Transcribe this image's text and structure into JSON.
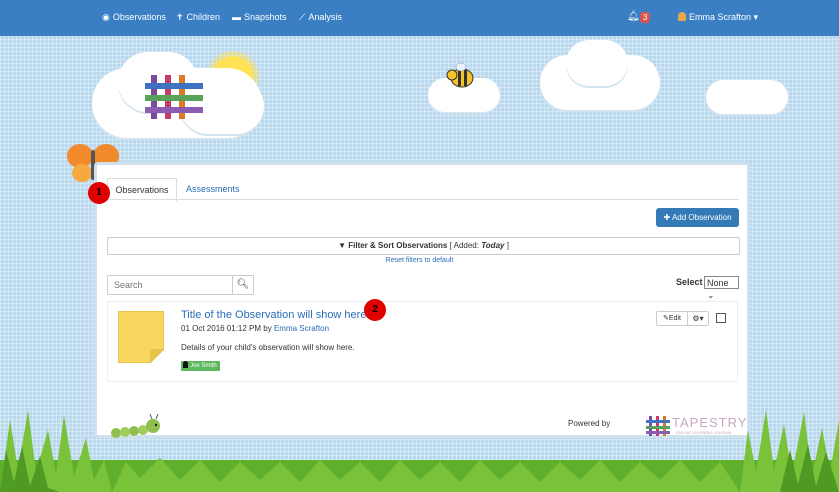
{
  "nav": {
    "items": [
      {
        "label": "Observations",
        "icon": "eye-icon"
      },
      {
        "label": "Children",
        "icon": "child-icon"
      },
      {
        "label": "Snapshots",
        "icon": "snapshot-icon"
      },
      {
        "label": "Analysis",
        "icon": "chart-icon"
      }
    ],
    "notification_count": "3",
    "user_name": "Emma Scrafton"
  },
  "tabs": [
    "Observations",
    "Assessments"
  ],
  "add_button": "Add Observation",
  "filter": {
    "label": "Filter & Sort Observations",
    "added_prefix": "[ Added: ",
    "added_value": "Today",
    "added_suffix": " ]",
    "reset_link": "Reset filters to default"
  },
  "search": {
    "placeholder": "Search"
  },
  "select": {
    "label": "Select",
    "value": "None"
  },
  "observation": {
    "title": "Title of the Observation will show here",
    "date": "01 Oct 2016 01:12 PM by ",
    "author": "Emma Scrafton",
    "details": "Details of your child's observation will show here.",
    "child_tag": "Joe Smith",
    "edit_label": "Edit"
  },
  "footer": {
    "powered_by": "Powered by",
    "brand": "TAPESTRY",
    "brand_sub": "ONLINE LEARNING JOURNAL"
  },
  "markers": [
    "1",
    "2"
  ],
  "colors": {
    "navbar": "#3a7fc4",
    "primary": "#337ab7",
    "link": "#2a6db5",
    "tag": "#5cb85c",
    "marker": "#e00000"
  }
}
